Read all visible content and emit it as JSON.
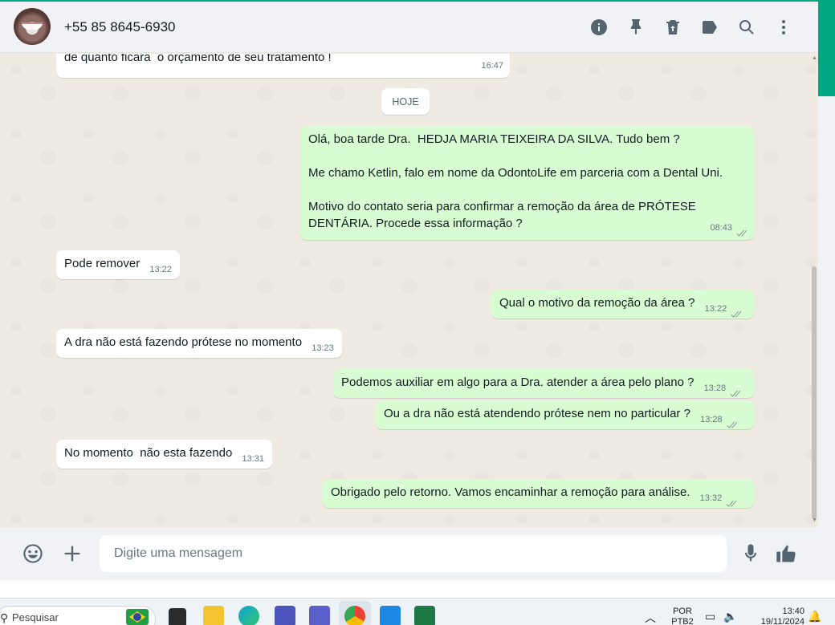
{
  "header": {
    "contact_name": "+55 85 8645-6930",
    "icons": [
      "info-icon",
      "pin-icon",
      "delete-icon",
      "label-icon",
      "search-icon",
      "menu-icon"
    ]
  },
  "chat": {
    "day_badge": "HOJE",
    "messages": [
      {
        "dir": "in",
        "text": "de quanto ficará  o orçamento de seu tratamento !",
        "time": "16:47",
        "ticks": false
      },
      {
        "dir": "out",
        "text": "Olá, boa tarde Dra.  HEDJA MARIA TEIXEIRA DA SILVA. Tudo bem ?\n\nMe chamo Ketlin, falo em nome da OdontoLife em parceria com a Dental Uni.\n\nMotivo do contato seria para confirmar a remoção da área de PRÓTESE DENTÁRIA. Procede essa informação ?",
        "time": "08:43",
        "ticks": true
      },
      {
        "dir": "in",
        "text": "Pode remover",
        "time": "13:22",
        "ticks": false
      },
      {
        "dir": "out",
        "text": "Qual o motivo da remoção da área ?",
        "time": "13:22",
        "ticks": true
      },
      {
        "dir": "in",
        "text": "A dra não está fazendo prótese no momento",
        "time": "13:23",
        "ticks": false
      },
      {
        "dir": "out",
        "text": "Podemos auxiliar em algo para a Dra. atender a área pelo plano ?",
        "time": "13:28",
        "ticks": true
      },
      {
        "dir": "out",
        "text": "Ou a dra não está atendendo prótese nem no particular ?",
        "time": "13:28",
        "ticks": true
      },
      {
        "dir": "in",
        "text": "No momento  não esta fazendo",
        "time": "13:31",
        "ticks": false
      },
      {
        "dir": "out",
        "text": "Obrigado pelo retorno. Vamos encaminhar a remoção para análise.",
        "time": "13:32",
        "ticks": true
      }
    ]
  },
  "composer": {
    "placeholder": "Digite uma mensagem",
    "icons": [
      "emoji-icon",
      "plus-icon",
      "microphone-icon",
      "thumbs-up-icon"
    ]
  },
  "taskbar": {
    "search_label": "Pesquisar",
    "language_top": "POR",
    "language_bottom": "PTB2",
    "time": "13:40",
    "date": "19/11/2024"
  },
  "colors": {
    "accent": "#00a884",
    "incoming_bubble": "#ffffff",
    "outgoing_bubble": "#d9fdd3",
    "chat_background": "#efeae2",
    "panel": "#f0f2f5"
  }
}
